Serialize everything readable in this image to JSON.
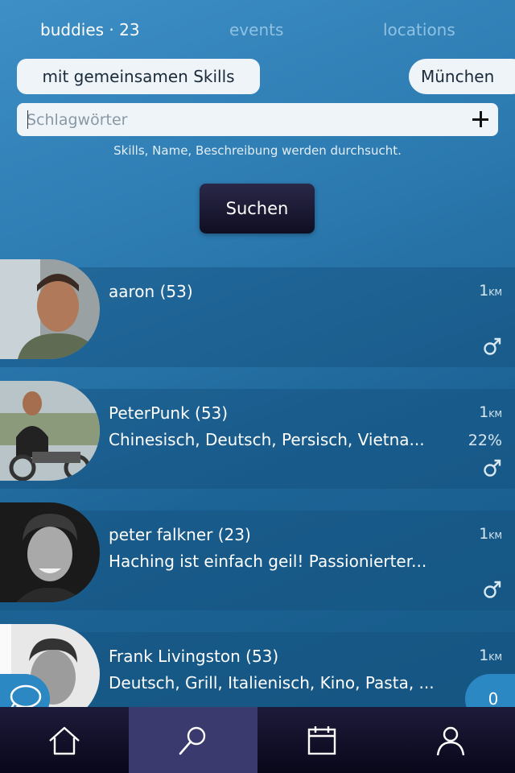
{
  "tabs": [
    {
      "label": "buddies · 23",
      "active": true
    },
    {
      "label": "events",
      "active": false
    },
    {
      "label": "locations",
      "active": false
    }
  ],
  "filters": {
    "skills_label": "mit gemeinsamen Skills",
    "city_label": "München"
  },
  "search": {
    "placeholder": "Schlagwörter",
    "value": "",
    "hint": "Skills, Name, Beschreibung werden durchsucht.",
    "button_label": "Suchen"
  },
  "results": [
    {
      "name": "aaron (53)",
      "desc": "",
      "dist": "1",
      "dist_unit": "KM",
      "match": "",
      "gender_icon": "male-icon"
    },
    {
      "name": "PeterPunk (53)",
      "desc": "Chinesisch, Deutsch, Persisch, Vietna...",
      "dist": "1",
      "dist_unit": "KM",
      "match": "22%",
      "gender_icon": "male-icon"
    },
    {
      "name": "peter falkner (23)",
      "desc": "Haching ist einfach geil! Passionierter...",
      "dist": "1",
      "dist_unit": "KM",
      "match": "",
      "gender_icon": "male-icon"
    },
    {
      "name": "Frank Livingston (53)",
      "desc": "Deutsch, Grill, Italienisch, Kino, Pasta, ...",
      "dist": "1",
      "dist_unit": "KM",
      "match": "",
      "gender_icon": "male-icon"
    }
  ],
  "chat_count": "0",
  "nav": [
    {
      "icon": "home-icon",
      "active": false
    },
    {
      "icon": "search-icon",
      "active": true
    },
    {
      "icon": "calendar-icon",
      "active": false
    },
    {
      "icon": "profile-icon",
      "active": false
    }
  ],
  "colors": {
    "accent": "#2b88c2",
    "nav_active": "#3b3a6e",
    "button_dark": "#0f0e22"
  }
}
